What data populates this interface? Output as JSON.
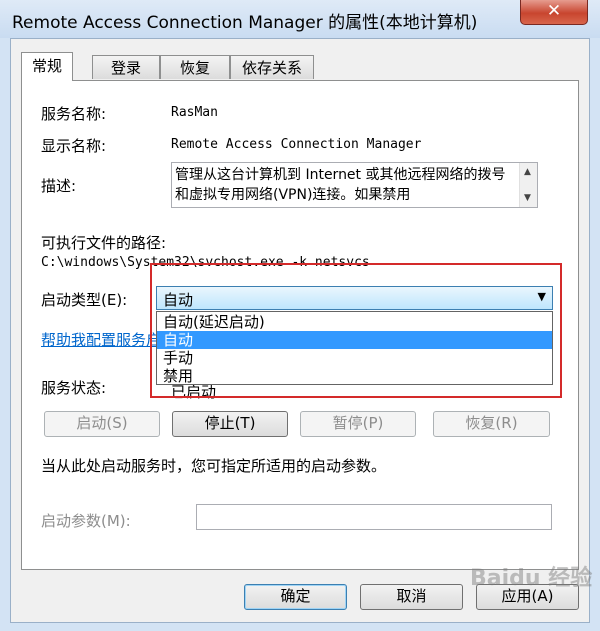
{
  "window": {
    "title": "Remote Access Connection Manager 的属性(本地计算机)",
    "close_glyph": "✕"
  },
  "tabs": [
    {
      "label": "常规"
    },
    {
      "label": "登录"
    },
    {
      "label": "恢复"
    },
    {
      "label": "依存关系"
    }
  ],
  "general": {
    "service_name_label": "服务名称:",
    "service_name": "RasMan",
    "display_name_label": "显示名称:",
    "display_name": "Remote Access Connection Manager",
    "description_label": "描述:",
    "description": "管理从这台计算机到 Internet 或其他远程网络的拨号和虚拟专用网络(VPN)连接。如果禁用",
    "exe_path_label": "可执行文件的路径:",
    "exe_path": "C:\\windows\\System32\\svchost.exe -k netsvcs",
    "startup_type_label": "启动类型(E):",
    "startup_type_value": "自动",
    "startup_options": [
      "自动(延迟启动)",
      "自动",
      "手动",
      "禁用"
    ],
    "startup_selected_index": 1,
    "help_link": "帮助我配置服务启",
    "service_status_label": "服务状态:",
    "service_status_value": "已启动",
    "buttons": {
      "start": "启动(S)",
      "stop": "停止(T)",
      "pause": "暂停(P)",
      "resume": "恢复(R)"
    },
    "hint": "当从此处启动服务时，您可指定所适用的启动参数。",
    "start_params_label": "启动参数(M):",
    "start_params_value": ""
  },
  "footer": {
    "ok": "确定",
    "cancel": "取消",
    "apply": "应用(A)"
  },
  "watermark": "Baidu 经验",
  "colors": {
    "highlight": "#3399ff",
    "annotation_box": "#d42a2a",
    "link": "#0066cc"
  }
}
